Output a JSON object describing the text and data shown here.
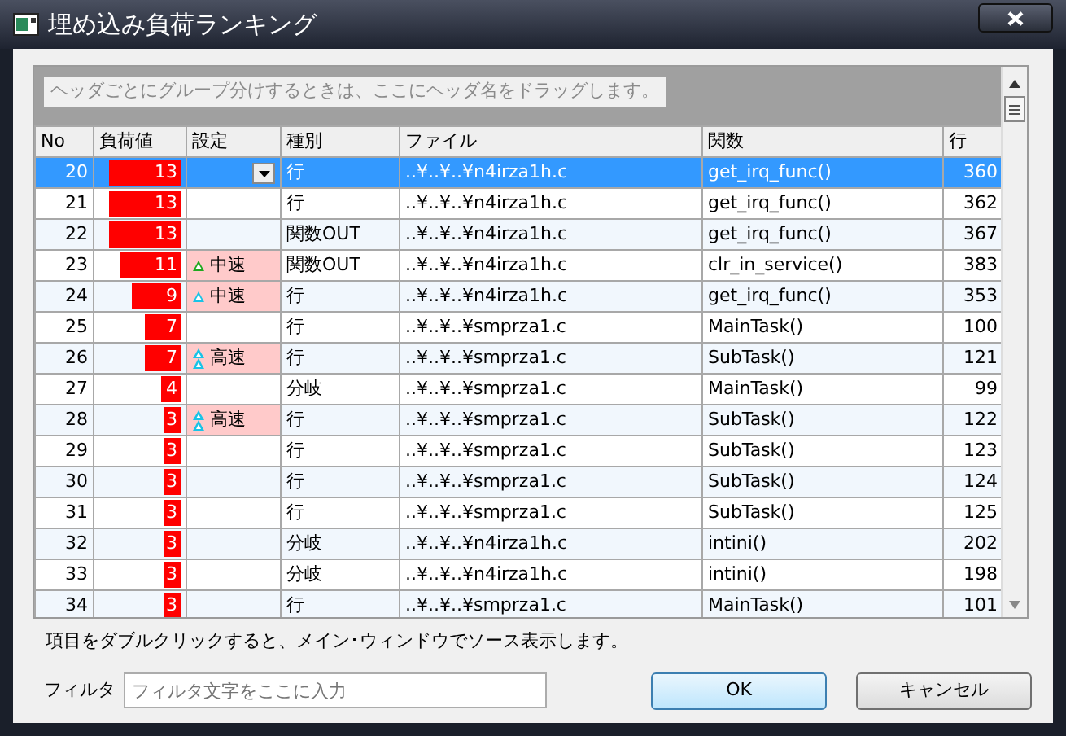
{
  "window": {
    "title": "埋め込み負荷ランキング"
  },
  "group_panel": {
    "hint": "ヘッダごとにグループ分けするときは、ここにヘッダ名をドラッグします。"
  },
  "table": {
    "columns": [
      "No",
      "負荷値",
      "設定",
      "種別",
      "ファイル",
      "関数",
      "行"
    ],
    "rows": [
      {
        "no": "20",
        "load": "13",
        "level": 0.89,
        "setting": null,
        "editing": true,
        "type": "行",
        "file": "..¥..¥..¥n4irza1h.c",
        "func": "get_irq_func()",
        "line": "360",
        "selected": true
      },
      {
        "no": "21",
        "load": "13",
        "level": 0.89,
        "setting": null,
        "editing": false,
        "type": "行",
        "file": "..¥..¥..¥n4irza1h.c",
        "func": "get_irq_func()",
        "line": "362",
        "selected": false
      },
      {
        "no": "22",
        "load": "13",
        "level": 0.89,
        "setting": null,
        "editing": false,
        "type": "関数OUT",
        "file": "..¥..¥..¥n4irza1h.c",
        "func": "get_irq_func()",
        "line": "367",
        "selected": false
      },
      {
        "no": "23",
        "load": "11",
        "level": 0.74,
        "setting": {
          "label": "中速",
          "kind": "single",
          "color": "#1fa81f"
        },
        "editing": false,
        "type": "関数OUT",
        "file": "..¥..¥..¥n4irza1h.c",
        "func": "clr_in_service()",
        "line": "383",
        "selected": false
      },
      {
        "no": "24",
        "load": "9",
        "level": 0.6,
        "setting": {
          "label": "中速",
          "kind": "single",
          "color": "#19c3e6"
        },
        "editing": false,
        "type": "行",
        "file": "..¥..¥..¥n4irza1h.c",
        "func": "get_irq_func()",
        "line": "353",
        "selected": false
      },
      {
        "no": "25",
        "load": "7",
        "level": 0.45,
        "setting": null,
        "editing": false,
        "type": "行",
        "file": "..¥..¥..¥smprza1.c",
        "func": "MainTask()",
        "line": "100",
        "selected": false
      },
      {
        "no": "26",
        "load": "7",
        "level": 0.45,
        "setting": {
          "label": "高速",
          "kind": "double",
          "color": "#19c3e6"
        },
        "editing": false,
        "type": "行",
        "file": "..¥..¥..¥smprza1.c",
        "func": "SubTask()",
        "line": "121",
        "selected": false
      },
      {
        "no": "27",
        "load": "4",
        "level": 0.25,
        "setting": null,
        "editing": false,
        "type": "分岐",
        "file": "..¥..¥..¥smprza1.c",
        "func": "MainTask()",
        "line": "99",
        "selected": false
      },
      {
        "no": "28",
        "load": "3",
        "level": 0.17,
        "setting": {
          "label": "高速",
          "kind": "double",
          "color": "#19c3e6"
        },
        "editing": false,
        "type": "行",
        "file": "..¥..¥..¥smprza1.c",
        "func": "SubTask()",
        "line": "122",
        "selected": false
      },
      {
        "no": "29",
        "load": "3",
        "level": 0.17,
        "setting": null,
        "editing": false,
        "type": "行",
        "file": "..¥..¥..¥smprza1.c",
        "func": "SubTask()",
        "line": "123",
        "selected": false
      },
      {
        "no": "30",
        "load": "3",
        "level": 0.17,
        "setting": null,
        "editing": false,
        "type": "行",
        "file": "..¥..¥..¥smprza1.c",
        "func": "SubTask()",
        "line": "124",
        "selected": false
      },
      {
        "no": "31",
        "load": "3",
        "level": 0.17,
        "setting": null,
        "editing": false,
        "type": "行",
        "file": "..¥..¥..¥smprza1.c",
        "func": "SubTask()",
        "line": "125",
        "selected": false
      },
      {
        "no": "32",
        "load": "3",
        "level": 0.17,
        "setting": null,
        "editing": false,
        "type": "分岐",
        "file": "..¥..¥..¥n4irza1h.c",
        "func": "intini()",
        "line": "202",
        "selected": false
      },
      {
        "no": "33",
        "load": "3",
        "level": 0.17,
        "setting": null,
        "editing": false,
        "type": "分岐",
        "file": "..¥..¥..¥n4irza1h.c",
        "func": "intini()",
        "line": "198",
        "selected": false
      },
      {
        "no": "34",
        "load": "3",
        "level": 0.17,
        "setting": null,
        "editing": false,
        "type": "行",
        "file": "..¥..¥..¥smprza1.c",
        "func": "MainTask()",
        "line": "101",
        "selected": false
      }
    ]
  },
  "hint": "項目をダブルクリックすると、メイン･ウィンドウでソース表示します。",
  "filter": {
    "label": "フィルタ",
    "placeholder": "フィルタ文字をここに入力"
  },
  "buttons": [
    {
      "label": "OK",
      "default": true
    },
    {
      "label": "キャンセル",
      "default": false
    }
  ]
}
